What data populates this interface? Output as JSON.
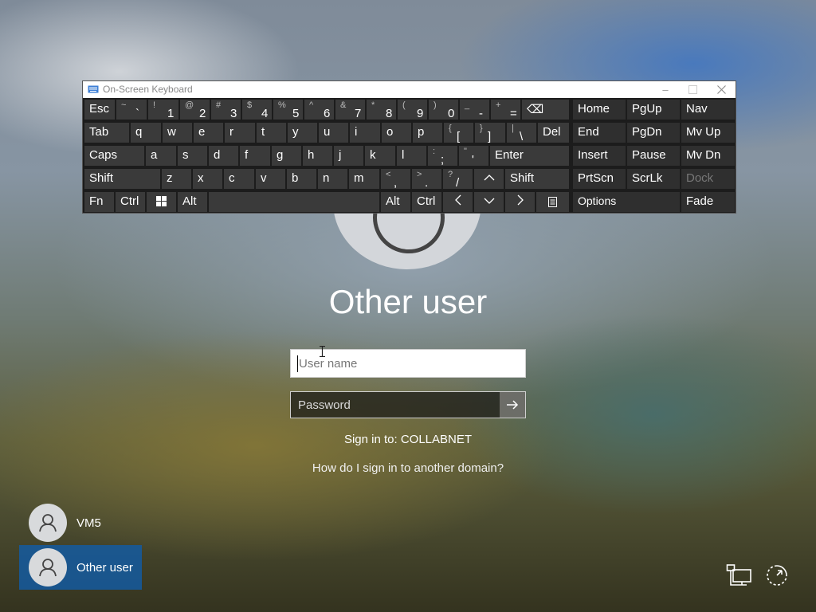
{
  "login": {
    "title": "Other user",
    "username_placeholder": "User name",
    "password_placeholder": "Password",
    "sign_in_to": "Sign in to: COLLABNET",
    "other_domain_link": "How do I sign in to another domain?"
  },
  "users": [
    {
      "name": "VM5",
      "selected": false
    },
    {
      "name": "Other user",
      "selected": true
    }
  ],
  "osk": {
    "title": "On-Screen Keyboard",
    "row1": {
      "esc": "Esc",
      "symbols": [
        {
          "shift": "~",
          "main": "`"
        },
        {
          "shift": "!",
          "main": "1"
        },
        {
          "shift": "@",
          "main": "2"
        },
        {
          "shift": "#",
          "main": "3"
        },
        {
          "shift": "$",
          "main": "4"
        },
        {
          "shift": "%",
          "main": "5"
        },
        {
          "shift": "^",
          "main": "6"
        },
        {
          "shift": "&",
          "main": "7"
        },
        {
          "shift": "*",
          "main": "8"
        },
        {
          "shift": "(",
          "main": "9"
        },
        {
          "shift": ")",
          "main": "0"
        },
        {
          "shift": "_",
          "main": "-"
        },
        {
          "shift": "+",
          "main": "="
        }
      ],
      "backspace": "⌫"
    },
    "row2": {
      "tab": "Tab",
      "letters": [
        "q",
        "w",
        "e",
        "r",
        "t",
        "y",
        "u",
        "i",
        "o",
        "p"
      ],
      "brackets": [
        {
          "shift": "{",
          "main": "["
        },
        {
          "shift": "}",
          "main": "]"
        },
        {
          "shift": "|",
          "main": "\\"
        }
      ],
      "del": "Del"
    },
    "row3": {
      "caps": "Caps",
      "letters": [
        "a",
        "s",
        "d",
        "f",
        "g",
        "h",
        "j",
        "k",
        "l"
      ],
      "punct": [
        {
          "shift": ":",
          "main": ";"
        },
        {
          "shift": "\"",
          "main": "'"
        }
      ],
      "enter": "Enter"
    },
    "row4": {
      "shift_left": "Shift",
      "letters": [
        "z",
        "x",
        "c",
        "v",
        "b",
        "n",
        "m"
      ],
      "punct": [
        {
          "shift": "<",
          "main": ","
        },
        {
          "shift": ">",
          "main": "."
        },
        {
          "shift": "?",
          "main": "/"
        }
      ],
      "shift_right": "Shift"
    },
    "row5": {
      "fn": "Fn",
      "ctrl_left": "Ctrl",
      "alt_left": "Alt",
      "alt_right": "Alt",
      "ctrl_right": "Ctrl"
    },
    "nav": {
      "home": "Home",
      "pgup": "PgUp",
      "nav": "Nav",
      "end": "End",
      "pgdn": "PgDn",
      "mvup": "Mv Up",
      "insert": "Insert",
      "pause": "Pause",
      "mvdn": "Mv Dn",
      "prtscn": "PrtScn",
      "scrlk": "ScrLk",
      "dock": "Dock",
      "options": "Options",
      "fade": "Fade"
    }
  },
  "icons": {
    "network": "network-icon",
    "ease_of_access": "ease-of-access-icon"
  }
}
